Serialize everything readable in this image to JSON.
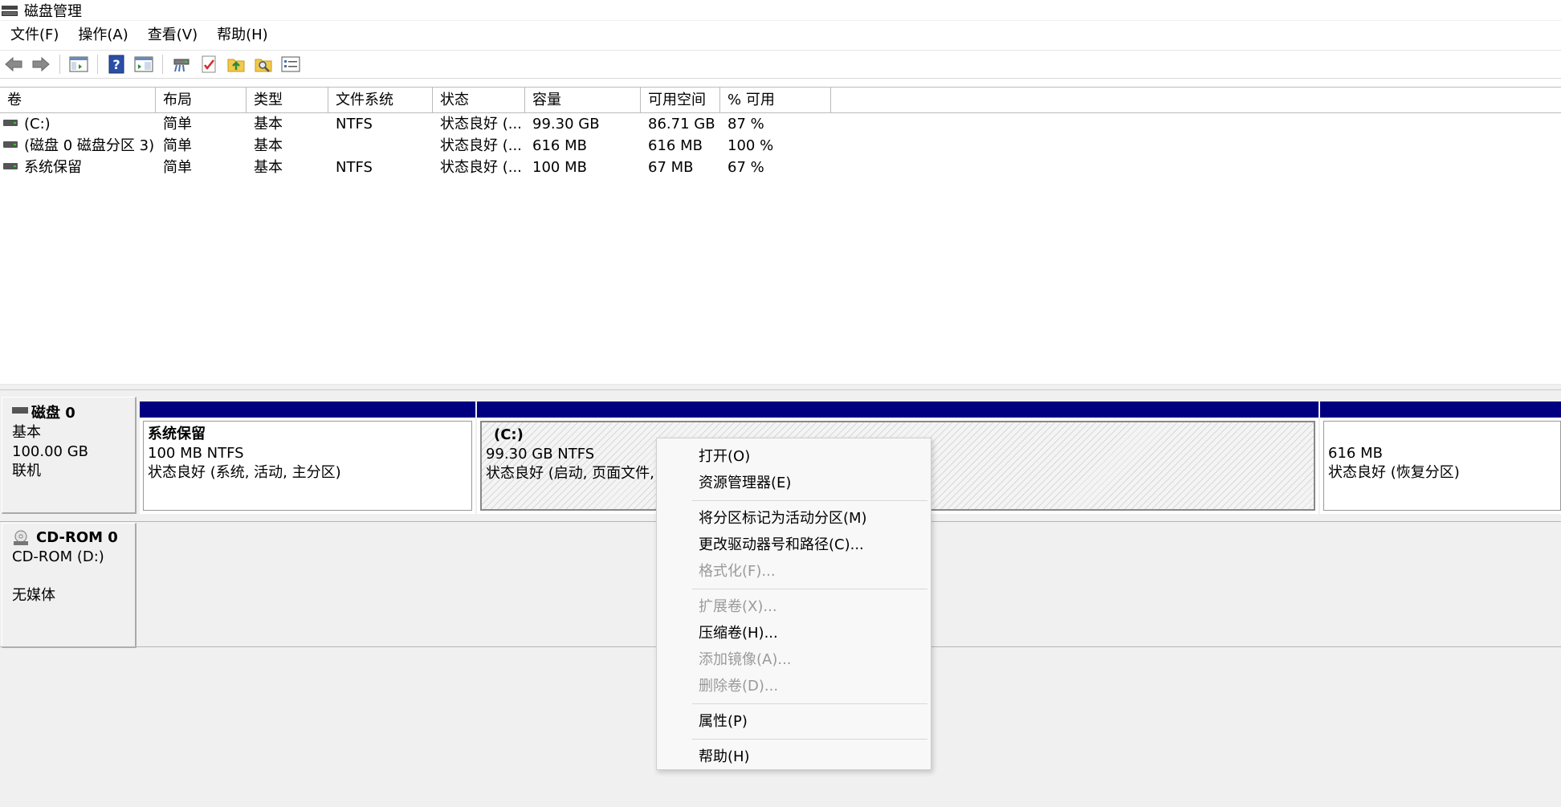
{
  "window": {
    "title": "磁盘管理"
  },
  "menu": [
    "文件(F)",
    "操作(A)",
    "查看(V)",
    "帮助(H)"
  ],
  "toolbar": {
    "icons": [
      "back-arrow-icon",
      "forward-arrow-icon",
      "console-view-icon",
      "help-icon",
      "properties-pane-icon",
      "connect-disk-icon",
      "checklist-icon",
      "folder-up-icon",
      "search-folder-icon",
      "settings-list-icon"
    ]
  },
  "volume_list": {
    "headers": [
      "卷",
      "布局",
      "类型",
      "文件系统",
      "状态",
      "容量",
      "可用空间",
      "% 可用"
    ],
    "rows": [
      [
        "(C:)",
        "简单",
        "基本",
        "NTFS",
        "状态良好 (...",
        "99.30 GB",
        "86.71 GB",
        "87 %"
      ],
      [
        "(磁盘 0 磁盘分区 3)",
        "简单",
        "基本",
        "",
        "状态良好 (...",
        "616 MB",
        "616 MB",
        "100 %"
      ],
      [
        "系统保留",
        "简单",
        "基本",
        "NTFS",
        "状态良好 (...",
        "100 MB",
        "67 MB",
        "67 %"
      ]
    ]
  },
  "disks": {
    "disk0": {
      "name": "磁盘 0",
      "type": "基本",
      "size": "100.00 GB",
      "state": "联机",
      "partitions": [
        {
          "name": "系统保留",
          "size": "100 MB NTFS",
          "status": "状态良好 (系统, 活动, 主分区)"
        },
        {
          "name": "(C:)",
          "size": "99.30 GB NTFS",
          "status": "状态良好 (启动, 页面文件, 故"
        },
        {
          "name": "",
          "size": "616 MB",
          "status": "状态良好 (恢复分区)"
        }
      ]
    },
    "cdrom0": {
      "name": "CD-ROM 0",
      "drive": "CD-ROM (D:)",
      "media": "无媒体"
    }
  },
  "context_menu": {
    "items": [
      {
        "label": "打开(O)",
        "enabled": true
      },
      {
        "label": "资源管理器(E)",
        "enabled": true
      },
      {
        "label": "将分区标记为活动分区(M)",
        "enabled": true
      },
      {
        "label": "更改驱动器号和路径(C)...",
        "enabled": true
      },
      {
        "label": "格式化(F)...",
        "enabled": false
      },
      {
        "label": "扩展卷(X)...",
        "enabled": false
      },
      {
        "label": "压缩卷(H)...",
        "enabled": true
      },
      {
        "label": "添加镜像(A)...",
        "enabled": false
      },
      {
        "label": "删除卷(D)...",
        "enabled": false
      },
      {
        "label": "属性(P)",
        "enabled": true
      },
      {
        "label": "帮助(H)",
        "enabled": true
      }
    ]
  }
}
